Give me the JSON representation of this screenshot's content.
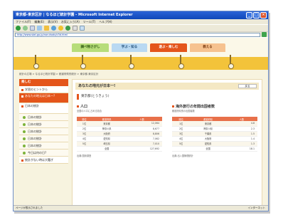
{
  "browser": {
    "title": "東京都-東京区計 | なるほど統計学園 - Microsoft Internet Explorer",
    "menu": [
      "ファイル(F)",
      "編集(E)",
      "表示(V)",
      "お気に入り(A)",
      "ツール(T)",
      "ヘルプ(H)"
    ],
    "address": "http://www.stat.go.jp/naruhodo/c3d.html",
    "status_left": "ページが表示されました",
    "status_right": "インターネット",
    "colors": {
      "title_bar": "#0f47b9",
      "chrome": "#ece9d8"
    }
  },
  "site": {
    "tabs": [
      {
        "label": "調べ物さがし"
      },
      {
        "label": "学ぶ・知る"
      },
      {
        "label": "遊ぶ・楽しむ"
      },
      {
        "label": "教える"
      }
    ],
    "breadcrumb": "統計の広場 > なるほど統計学園 > 都道府県別統計 > 東京都-東京区計",
    "accent": "#e4551b",
    "band": "#f3c33a"
  },
  "sidebar": {
    "head": "楽しむ",
    "items": [
      {
        "label": "学習のヒントから"
      },
      {
        "label": "あなたの地元は日本一?"
      },
      {
        "label": "日本の統計"
      },
      {
        "label": "日本の統計"
      },
      {
        "label": "日本の統計"
      },
      {
        "label": "日本の統計"
      },
      {
        "label": "日本の統計"
      },
      {
        "label": "日本の統計"
      },
      {
        "label": "今日は何の日?"
      },
      {
        "label": "統計がない時は大騒ぎ"
      }
    ]
  },
  "main": {
    "title": "あなたの地元が日本一!",
    "button": "戻る",
    "city": "東京都(とうきょう)",
    "left": {
      "title": "人口",
      "desc": "全国の人口に占める割合",
      "headers": [
        "順位",
        "都道府県",
        "人数"
      ],
      "rows": [
        [
          "1位",
          "東京都",
          "12,064"
        ],
        [
          "2位",
          "神奈川県",
          "8,677"
        ],
        [
          "3位",
          "大阪府",
          "8,806"
        ],
        [
          "4位",
          "愛知県",
          "7,062"
        ],
        [
          "5位",
          "埼玉県",
          "7,010"
        ],
        [
          "",
          "全国",
          "127,692"
        ]
      ],
      "source": "出典:国勢調査"
    },
    "right": {
      "title": "海外旅行の年間出国者数",
      "desc": "都道府県別の出国者数",
      "headers": [
        "順位",
        "都道府県",
        "人数"
      ],
      "rows": [
        [
          "1位",
          "東京都",
          "4.8"
        ],
        [
          "2位",
          "神奈川県",
          "2.3"
        ],
        [
          "3位",
          "千葉県",
          "1.5"
        ],
        [
          "4位",
          "大阪府",
          "1.4"
        ],
        [
          "5位",
          "愛知県",
          "1.3"
        ],
        [
          "",
          "全国",
          "18.1"
        ]
      ],
      "source": "出典:出入国管理統計"
    }
  }
}
